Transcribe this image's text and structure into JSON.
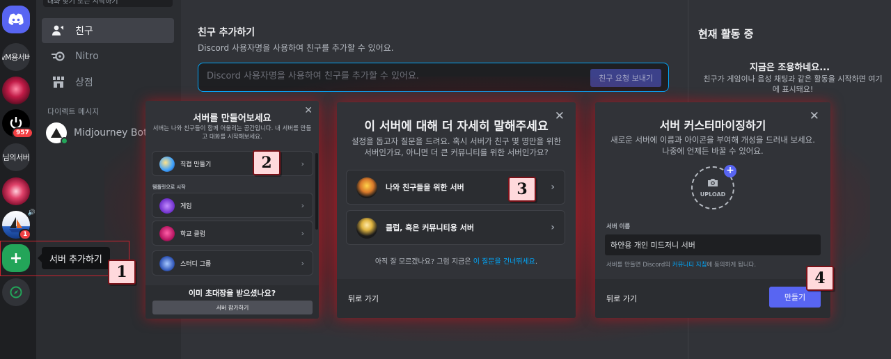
{
  "rail": {
    "text_server_1": "vM용서버",
    "text_server_2": "님의서버",
    "badge_957": "957",
    "badge_1": "1"
  },
  "sidebar": {
    "search_placeholder": "대화 찾기 또는 시작하기",
    "items": [
      {
        "label": "친구",
        "icon": "friends-icon"
      },
      {
        "label": "Nitro",
        "icon": "nitro-icon"
      },
      {
        "label": "상점",
        "icon": "shop-icon"
      }
    ],
    "dm_header": "다이렉트 메시지",
    "dm_user": "Midjourney Bot"
  },
  "tooltip": "서버 추가하기",
  "main": {
    "title": "친구 추가하기",
    "description": "Discord 사용자명을 사용하여 친구를 추가할 수 있어요.",
    "input_placeholder": "Discord 사용자명을 사용하여 친구를 추가할 수 있어요.",
    "send_button": "친구 요청 보내기"
  },
  "activity": {
    "title": "현재 활동 중",
    "quiet": "지금은 조용하네요...",
    "description": "친구가 게임이나 음성 채팅과 같은 활동을 시작하면 여기에 표시돼요!"
  },
  "modal_create": {
    "title": "서버를 만들어보세요",
    "subtitle": "서버는 나와 친구들이 함께 어울리는 공간입니다. 내 서버를 만들고 대화를 시작해보세요.",
    "create_own": "직접 만들기",
    "template_header": "템플릿으로 시작",
    "templates": [
      "게임",
      "학교 클럽",
      "스터디 그룹"
    ],
    "invite_question": "이미 초대장을 받으셨나요?",
    "join_button": "서버 참가하기"
  },
  "modal_about": {
    "title": "이 서버에 대해 더 자세히 말해주세요",
    "subtitle": "설정을 돕고자 질문을 드려요. 혹시 서버가 친구 몇 명만을 위한 서버인가요, 아니면 더 큰 커뮤니티를 위한 서버인가요?",
    "option_friends": "나와 친구들을 위한 서버",
    "option_community": "클럽, 혹은 커뮤니티용 서버",
    "skip_text": "아직 잘 모르겠나요? 그럼 지금은 ",
    "skip_link": "이 질문을 건너뛰세요",
    "skip_end": ".",
    "back": "뒤로 가기"
  },
  "modal_customize": {
    "title": "서버 커스터마이징하기",
    "subtitle": "새로운 서버에 이름과 아이콘을 부여해 개성을 드러내 보세요. 나중에 언제든 바꿀 수 있어요.",
    "upload": "UPLOAD",
    "name_label": "서버 이름",
    "name_value": "하얀용 개인 미드저니 서버",
    "terms_prefix": "서버를 만들면 Discord의 ",
    "terms_link": "커뮤니티 지침",
    "terms_suffix": "에 동의하게 됩니다.",
    "back": "뒤로 가기",
    "create": "만들기"
  },
  "steps": [
    "1",
    "2",
    "3",
    "4"
  ],
  "colors": {
    "blurple": "#5865f2",
    "green": "#23a559",
    "link": "#00a8fc",
    "marker_fill": "#ffd9dc",
    "marker_border": "#7a1118",
    "highlight": "#d0232f"
  }
}
